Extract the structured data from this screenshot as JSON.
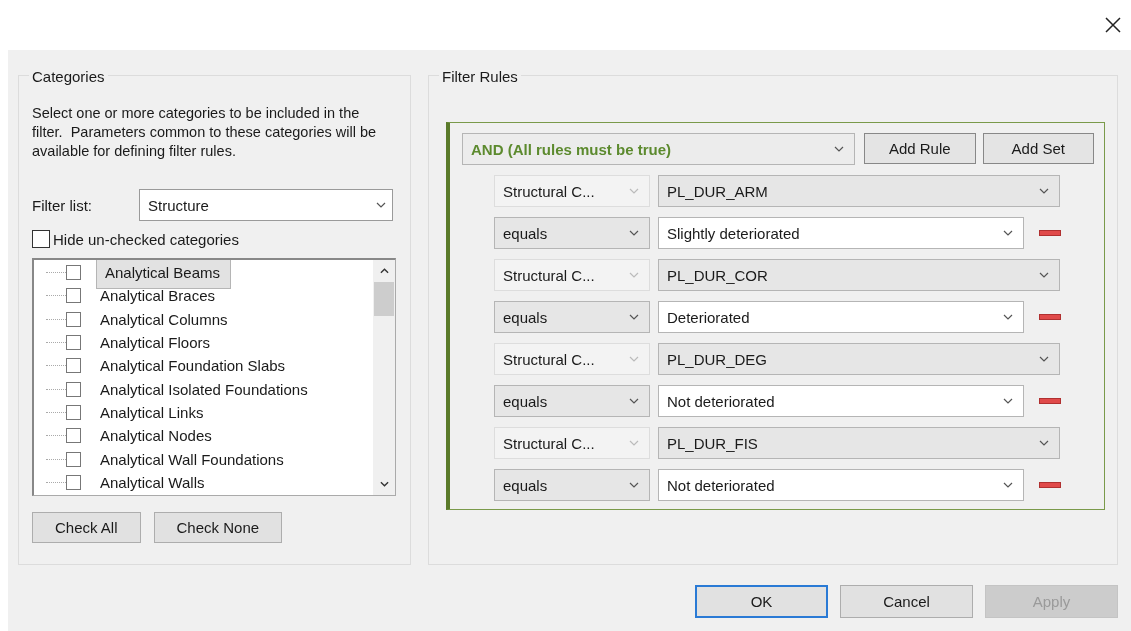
{
  "categories": {
    "title": "Categories",
    "description": "Select one or more categories to be included in the filter.  Parameters common to these categories will be available for defining filter rules.",
    "filter_list": {
      "label": "Filter list:",
      "value": "Structure"
    },
    "hide_unchecked": {
      "label": "Hide un-checked categories",
      "checked": false
    },
    "items": [
      {
        "label": "Analytical Beams",
        "checked": false,
        "selected": true
      },
      {
        "label": "Analytical Braces",
        "checked": false,
        "selected": false
      },
      {
        "label": "Analytical Columns",
        "checked": false,
        "selected": false
      },
      {
        "label": "Analytical Floors",
        "checked": false,
        "selected": false
      },
      {
        "label": "Analytical Foundation Slabs",
        "checked": false,
        "selected": false
      },
      {
        "label": "Analytical Isolated Foundations",
        "checked": false,
        "selected": false
      },
      {
        "label": "Analytical Links",
        "checked": false,
        "selected": false
      },
      {
        "label": "Analytical Nodes",
        "checked": false,
        "selected": false
      },
      {
        "label": "Analytical Wall Foundations",
        "checked": false,
        "selected": false
      },
      {
        "label": "Analytical Walls",
        "checked": false,
        "selected": false
      }
    ],
    "buttons": [
      "Check All",
      "Check None"
    ]
  },
  "filter_rules": {
    "title": "Filter Rules",
    "logic": "AND (All rules must be true)",
    "set_buttons": [
      "Add Rule",
      "Add Set"
    ],
    "rules": [
      {
        "category": "Structural C...",
        "category_disabled": true,
        "parameter": "PL_DUR_ARM",
        "operator": "equals",
        "value": "Slightly deteriorated"
      },
      {
        "category": "Structural C...",
        "category_disabled": true,
        "parameter": "PL_DUR_COR",
        "operator": "equals",
        "value": "Deteriorated"
      },
      {
        "category": "Structural C...",
        "category_disabled": true,
        "parameter": "PL_DUR_DEG",
        "operator": "equals",
        "value": "Not deteriorated"
      },
      {
        "category": "Structural C...",
        "category_disabled": true,
        "parameter": "PL_DUR_FIS",
        "operator": "equals",
        "value": "Not deteriorated"
      }
    ]
  },
  "dialog_buttons": [
    {
      "label": "OK",
      "default": true,
      "disabled": false
    },
    {
      "label": "Cancel",
      "default": false,
      "disabled": false
    },
    {
      "label": "Apply",
      "default": false,
      "disabled": true
    }
  ]
}
